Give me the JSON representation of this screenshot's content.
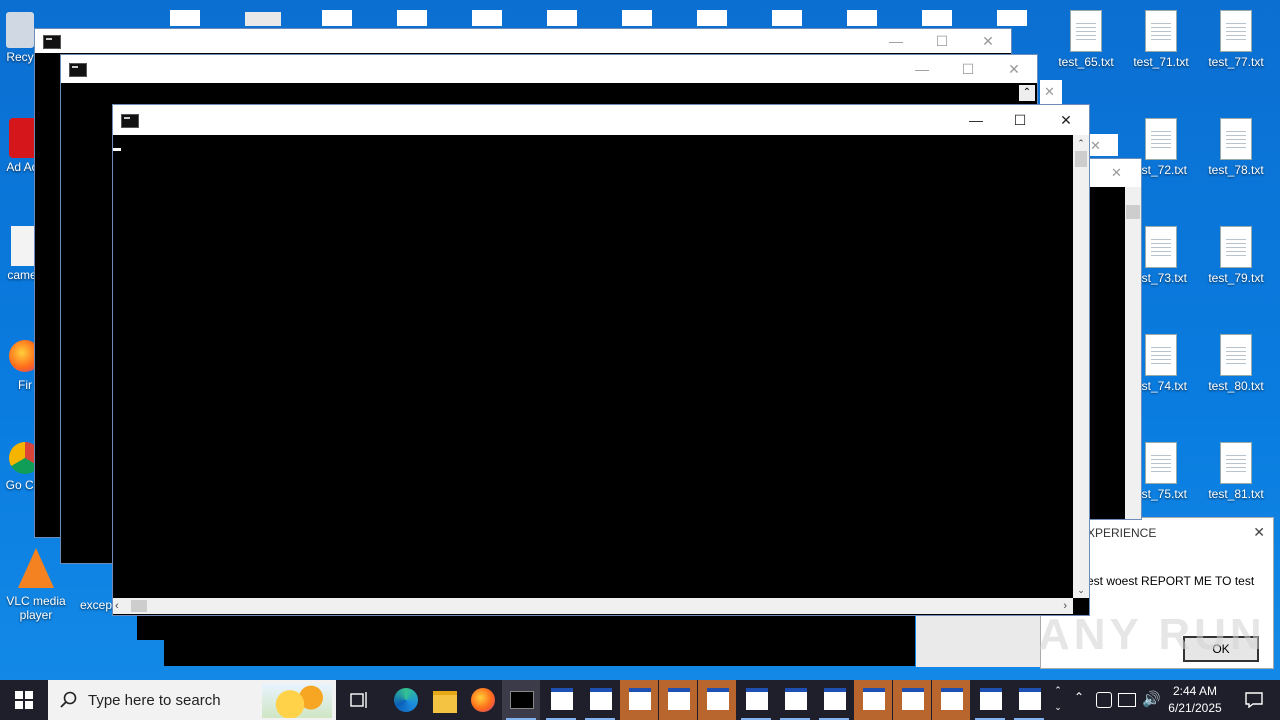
{
  "desktop": {
    "left_icons": [
      {
        "label": "Recy",
        "icon": "recycle-bin-icon"
      },
      {
        "label": "Ad Acr",
        "icon": "acrobat-icon"
      },
      {
        "label": "camer",
        "icon": "camera-file-icon"
      },
      {
        "label": "Fir",
        "icon": "firefox-icon"
      },
      {
        "label": "Go Chr",
        "icon": "chrome-icon"
      },
      {
        "label": "VLC media player",
        "icon": "vlc-icon"
      },
      {
        "label": "excep",
        "icon": "exception-file-icon"
      }
    ],
    "right_icons": [
      {
        "label": "test_65.txt"
      },
      {
        "label": "test_71.txt"
      },
      {
        "label": "test_77.txt"
      },
      {
        "label": "est_72.txt"
      },
      {
        "label": "test_78.txt"
      },
      {
        "label": "est_73.txt"
      },
      {
        "label": "test_79.txt"
      },
      {
        "label": "est_74.txt"
      },
      {
        "label": "test_80.txt"
      },
      {
        "label": "est_75.txt"
      },
      {
        "label": "test_81.txt"
      }
    ]
  },
  "front_window": {
    "title_icon": "cmd-icon",
    "minimize": "—",
    "maximize": "☐",
    "close": "✕"
  },
  "dialog": {
    "title": "XPERIENCE",
    "message": "est woest REPORT ME TO test",
    "ok": "OK",
    "close": "✕"
  },
  "watermark": "ANY RUN",
  "taskbar": {
    "search_placeholder": "Type here to search",
    "time": "2:44 AM",
    "date": "6/21/2025"
  }
}
